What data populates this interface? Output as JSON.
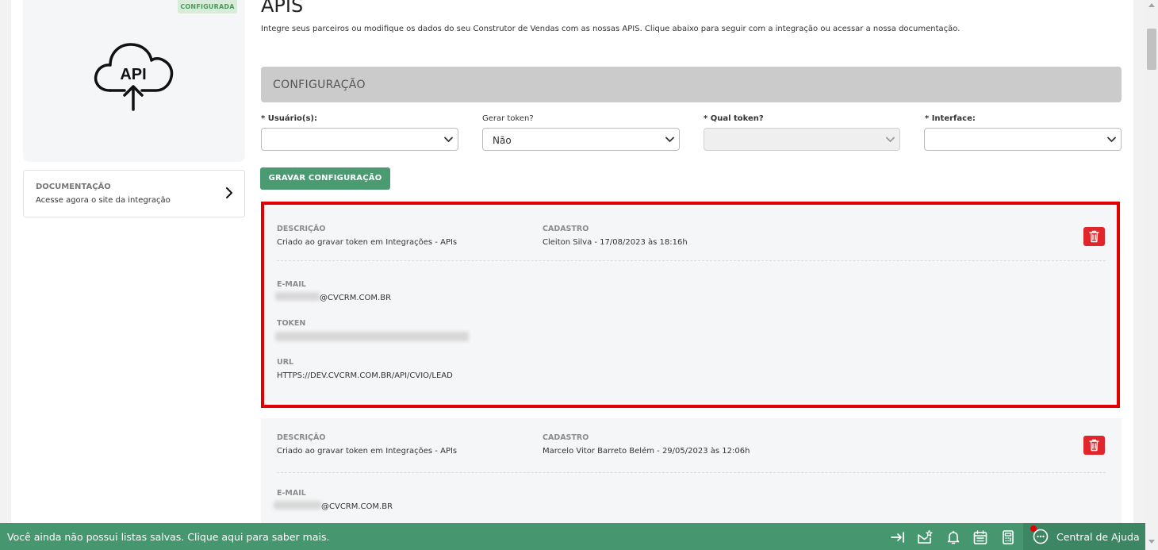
{
  "left": {
    "badge": "CONFIGURADA",
    "api_icon_text": "API",
    "doc": {
      "title": "DOCUMENTAÇÃO",
      "subtitle": "Acesse agora o site da integração"
    }
  },
  "header": {
    "title": "APIS",
    "subtitle": "Integre seus parceiros ou modifique os dados do seu Construtor de Vendas com as nossas APIS. Clique abaixo para seguir com a integração ou acessar a nossa documentação."
  },
  "config": {
    "section_title": "CONFIGURAÇÃO",
    "fields": [
      {
        "label": "* Usuário(s):",
        "value": ""
      },
      {
        "label": "Gerar token?",
        "value": "Não"
      },
      {
        "label": "* Qual token?",
        "value": ""
      },
      {
        "label": "* Interface:",
        "value": ""
      }
    ],
    "save_label": "GRAVAR CONFIGURAÇÃO"
  },
  "labels": {
    "descricao": "DESCRIÇÃO",
    "cadastro": "CADASTRO",
    "email": "E-MAIL",
    "token": "TOKEN",
    "url": "URL"
  },
  "tokens": [
    {
      "descricao": "Criado ao gravar token em Integrações - APIs",
      "cadastro": "Cleiton Silva - 17/08/2023 às 18:16h",
      "email_suffix": "@CVCRM.COM.BR",
      "url": "HTTPS://DEV.CVCRM.COM.BR/API/CVIO/LEAD"
    },
    {
      "descricao": "Criado ao gravar token em Integrações - APIs",
      "cadastro": "Marcelo Vitor Barreto Belém - 29/05/2023 às 12:06h",
      "email_suffix": "@CVCRM.COM.BR"
    }
  ],
  "footer": {
    "message": "Você ainda não possui listas salvas. Clique aqui para saber mais.",
    "help_label": "Central de Ajuda",
    "icons": [
      "expand-icon",
      "mail-star-icon",
      "bell-icon",
      "calendar-icon",
      "calculator-icon"
    ]
  },
  "colors": {
    "primary_green": "#46966f",
    "danger_red": "#e0262b",
    "highlight_red": "#e30000"
  }
}
